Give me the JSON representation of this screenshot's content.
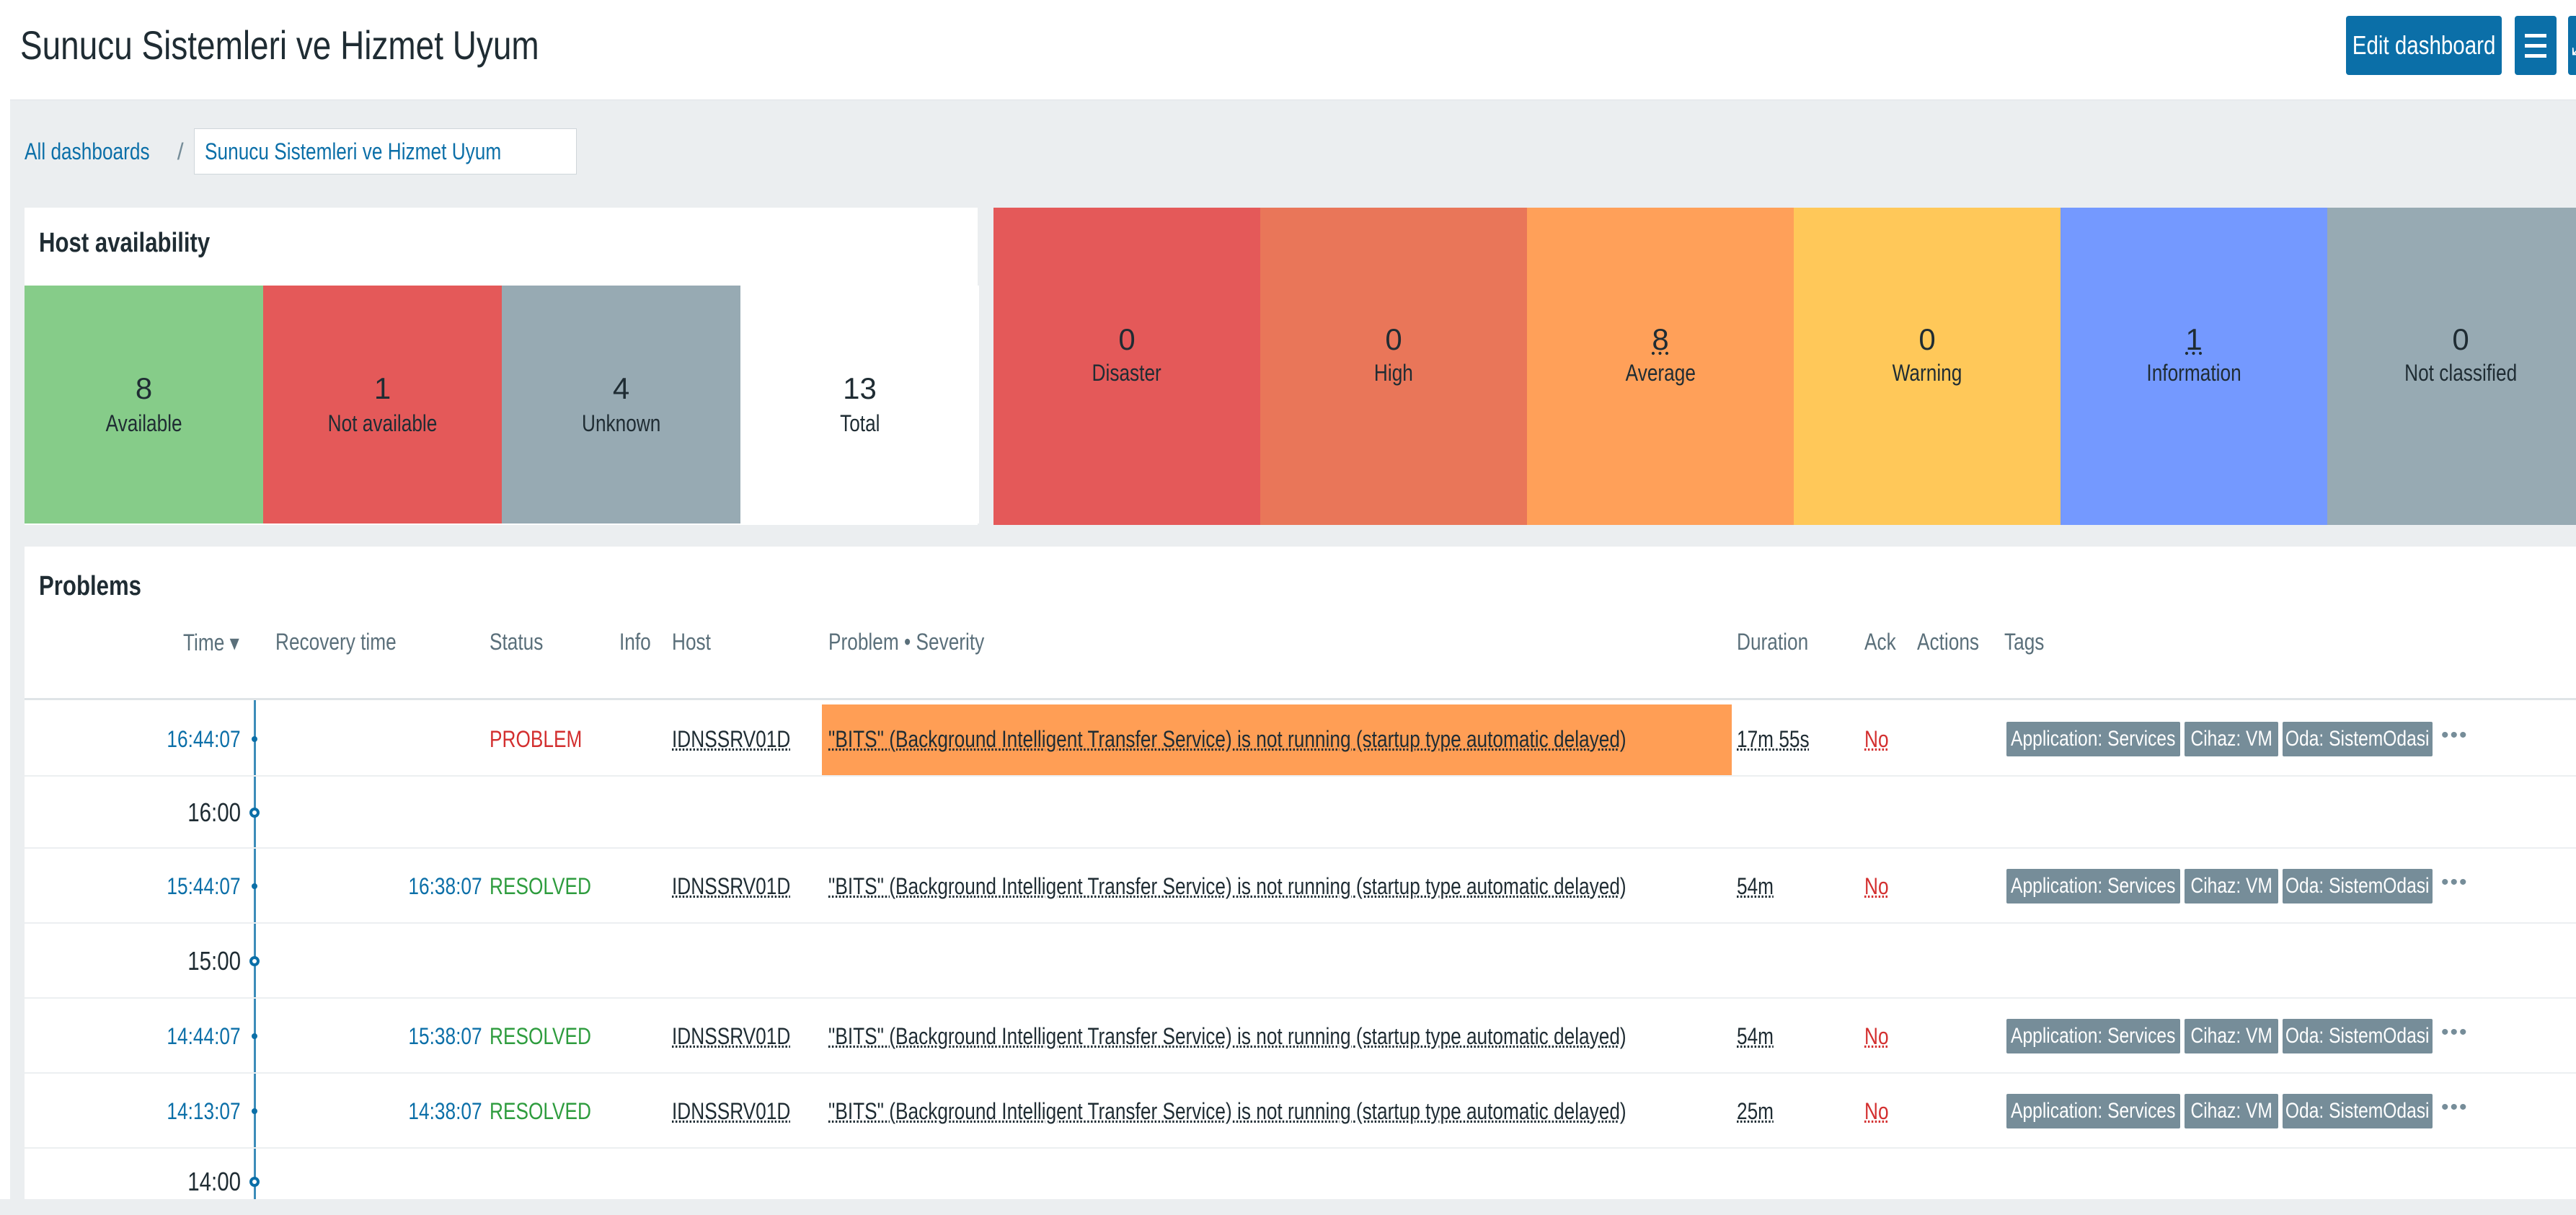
{
  "header": {
    "title": "Sunucu Sistemleri ve Hizmet Uyum",
    "edit_button": "Edit dashboard",
    "menu_icon": "hamburger-menu-icon",
    "fullscreen_icon": "fullscreen-icon"
  },
  "breadcrumb": {
    "all": "All dashboards",
    "separator": "/",
    "current": "Sunucu Sistemleri ve Hizmet Uyum"
  },
  "host_availability": {
    "title": "Host availability",
    "cells": [
      {
        "value": "8",
        "label": "Available",
        "color": "#86cc89"
      },
      {
        "value": "1",
        "label": "Not available",
        "color": "#e45959"
      },
      {
        "value": "4",
        "label": "Unknown",
        "color": "#97aab3"
      },
      {
        "value": "13",
        "label": "Total",
        "color": "#ffffff"
      }
    ]
  },
  "severity": [
    {
      "value": "0",
      "label": "Disaster",
      "color": "#e45959"
    },
    {
      "value": "0",
      "label": "High",
      "color": "#e97659"
    },
    {
      "value": "8",
      "label": "Average",
      "color": "#ffa059"
    },
    {
      "value": "0",
      "label": "Warning",
      "color": "#ffc859"
    },
    {
      "value": "1",
      "label": "Information",
      "color": "#7499ff"
    },
    {
      "value": "0",
      "label": "Not classified",
      "color": "#97aab3"
    }
  ],
  "problems": {
    "title": "Problems",
    "columns": {
      "time": "Time ▾",
      "recovery": "Recovery time",
      "status": "Status",
      "info": "Info",
      "host": "Host",
      "problem": "Problem • Severity",
      "duration": "Duration",
      "ack": "Ack",
      "actions": "Actions",
      "tags": "Tags"
    },
    "rows": [
      {
        "time": "16:44:07",
        "recovery": "",
        "status": "PROBLEM",
        "host": "IDNSSRV01D",
        "problem": "\"BITS\" (Background Intelligent Transfer Service) is not running (startup type automatic delayed)",
        "duration": "17m 55s",
        "ack": "No",
        "tags": [
          "Application: Services",
          "Cihaz: VM",
          "Oda: SistemOdasi"
        ],
        "more": "•••"
      },
      {
        "hour": "16:00"
      },
      {
        "time": "15:44:07",
        "recovery": "16:38:07",
        "status": "RESOLVED",
        "host": "IDNSSRV01D",
        "problem": "\"BITS\" (Background Intelligent Transfer Service) is not running (startup type automatic delayed)",
        "duration": "54m",
        "ack": "No",
        "tags": [
          "Application: Services",
          "Cihaz: VM",
          "Oda: SistemOdasi"
        ],
        "more": "•••"
      },
      {
        "hour": "15:00"
      },
      {
        "time": "14:44:07",
        "recovery": "15:38:07",
        "status": "RESOLVED",
        "host": "IDNSSRV01D",
        "problem": "\"BITS\" (Background Intelligent Transfer Service) is not running (startup type automatic delayed)",
        "duration": "54m",
        "ack": "No",
        "tags": [
          "Application: Services",
          "Cihaz: VM",
          "Oda: SistemOdasi"
        ],
        "more": "•••"
      },
      {
        "time": "14:13:07",
        "recovery": "14:38:07",
        "status": "RESOLVED",
        "host": "IDNSSRV01D",
        "problem": "\"BITS\" (Background Intelligent Transfer Service) is not running (startup type automatic delayed)",
        "duration": "25m",
        "ack": "No",
        "tags": [
          "Application: Services",
          "Cihaz: VM",
          "Oda: SistemOdasi"
        ],
        "more": "•••"
      },
      {
        "hour": "14:00"
      }
    ],
    "colors": {
      "problem": "#d32f2f",
      "resolved": "#2e9c3e",
      "average_severity": "#ff9e55"
    }
  }
}
